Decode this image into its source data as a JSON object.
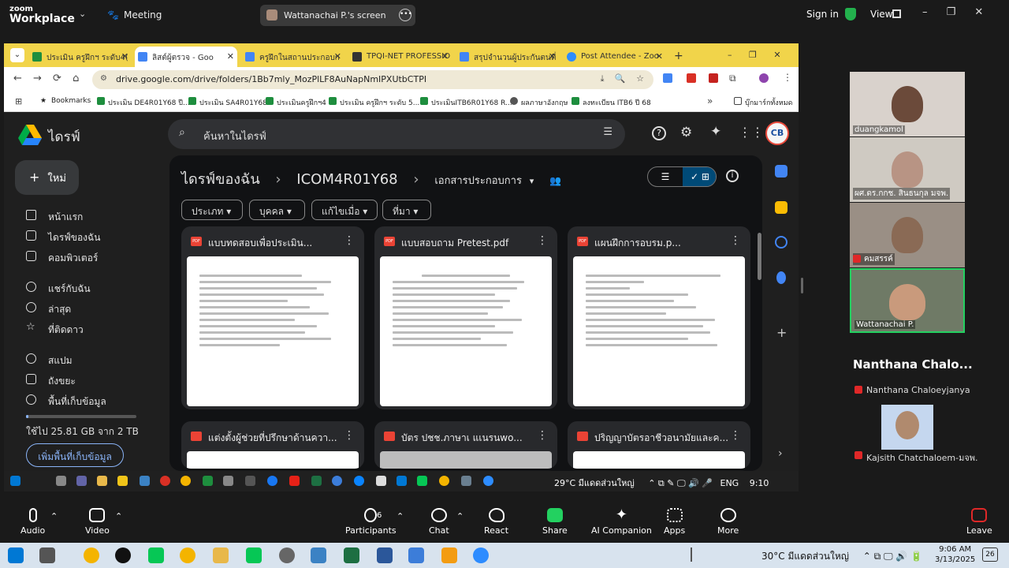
{
  "zoom": {
    "logo_line1": "zoom",
    "logo_line2": "Workplace",
    "meeting_label": "Meeting",
    "screen_share_label": "Wattanachai P.'s screen",
    "sign_in": "Sign in",
    "view": "View"
  },
  "browser": {
    "tabs": [
      {
        "label": "ประเมิน ครูฝึกฯ ระดับ4(",
        "color": "#1e8e3e"
      },
      {
        "label": "ลิสต์ผู้ตรวจ - Goo",
        "color": "#4285f4"
      },
      {
        "label": "ครูฝึกในสถานประกอบก",
        "color": "#4285f4"
      },
      {
        "label": "TPQI-NET PROFESSIO",
        "color": "#333333"
      },
      {
        "label": "สรุปจำนวนผู้ประกันตนที่",
        "color": "#4285f4"
      },
      {
        "label": "Post Attendee - Zoo",
        "color": "#2d8cff"
      }
    ],
    "url": "drive.google.com/drive/folders/1Bb7mly_MozPlLF8AuNapNmIPXUtbCTPI",
    "bookmarks": [
      "Bookmarks",
      "ประเมิน DE4R01Y68 ปี...",
      "ประเมิน SA4R01Y68",
      "ประเมินครูฝึกฯ4",
      "ประเมิน ครูฝึกฯ ระดับ 5...",
      "ประเมินITB6R01Y68 R...",
      "ผลภาษาอังกฤษ",
      "ลงทะเบียน ITB6 ปี 68"
    ],
    "bookmark_folder": "บุ๊กมาร์กทั้งหมด"
  },
  "drive": {
    "title": "ไดรฟ์",
    "search_placeholder": "ค้นหาในไดรฟ์",
    "new_button": "ใหม่",
    "nav": [
      "หน้าแรก",
      "ไดรฟ์ของฉัน",
      "คอมพิวเตอร์",
      "แชร์กับฉัน",
      "ล่าสุด",
      "ที่ติดดาว",
      "สแปม",
      "ถังขยะ",
      "พื้นที่เก็บข้อมูล"
    ],
    "storage_text": "ใช้ไป 25.81 GB จาก 2 TB",
    "storage_used_fraction": 0.013,
    "storage_button": "เพิ่มพื้นที่เก็บข้อมูล",
    "breadcrumb_root": "ไดรฟ์ของฉัน",
    "breadcrumb_folder": "ICOM4R01Y68",
    "breadcrumb_current": "เอกสารประกอบการ",
    "filters": [
      "ประเภท",
      "บุคคล",
      "แก้ไขเมื่อ",
      "ที่มา"
    ],
    "files_row1": [
      "แบบทดสอบเพื่อประเมิน...",
      "แบบสอบถาม Pretest.pdf",
      "แผนฝึกการอบรม.p..."
    ],
    "files_row2": [
      "แต่งตั้งผู้ช่วยที่ปรึกษาด้านควา...",
      "บัตร ปชช.ภาษาเ แเนรนwo...",
      "ปริญญาบัตรอาชีวอนามัยและค..."
    ],
    "file_badge": "PDF"
  },
  "screen_taskbar": {
    "weather": "29°C  มีแดดส่วนใหญ่",
    "lang": "ENG",
    "time": "9:10"
  },
  "participants": [
    {
      "name": "duangkamol"
    },
    {
      "name": "ผศ.ดร.กกช. สินธนกุล มจพ."
    },
    {
      "name": "คมสรรค์"
    },
    {
      "name": "Wattanachai P."
    }
  ],
  "participant_big_name": "Nanthana Chalo...",
  "participant_sub1": "Nanthana Chaloeyjanya",
  "participant_sub2": "Kajsith Chatchaloem-มจพ.",
  "toolbar": {
    "audio": "Audio",
    "video": "Video",
    "participants": "Participants",
    "participants_count": "6",
    "chat": "Chat",
    "react": "React",
    "share": "Share",
    "ai": "AI Companion",
    "apps": "Apps",
    "more": "More",
    "leave": "Leave"
  },
  "windows": {
    "weather": "30°C  มีแดดส่วนใหญ่",
    "time": "9:06 AM",
    "date": "3/13/2025",
    "notif": "26"
  }
}
